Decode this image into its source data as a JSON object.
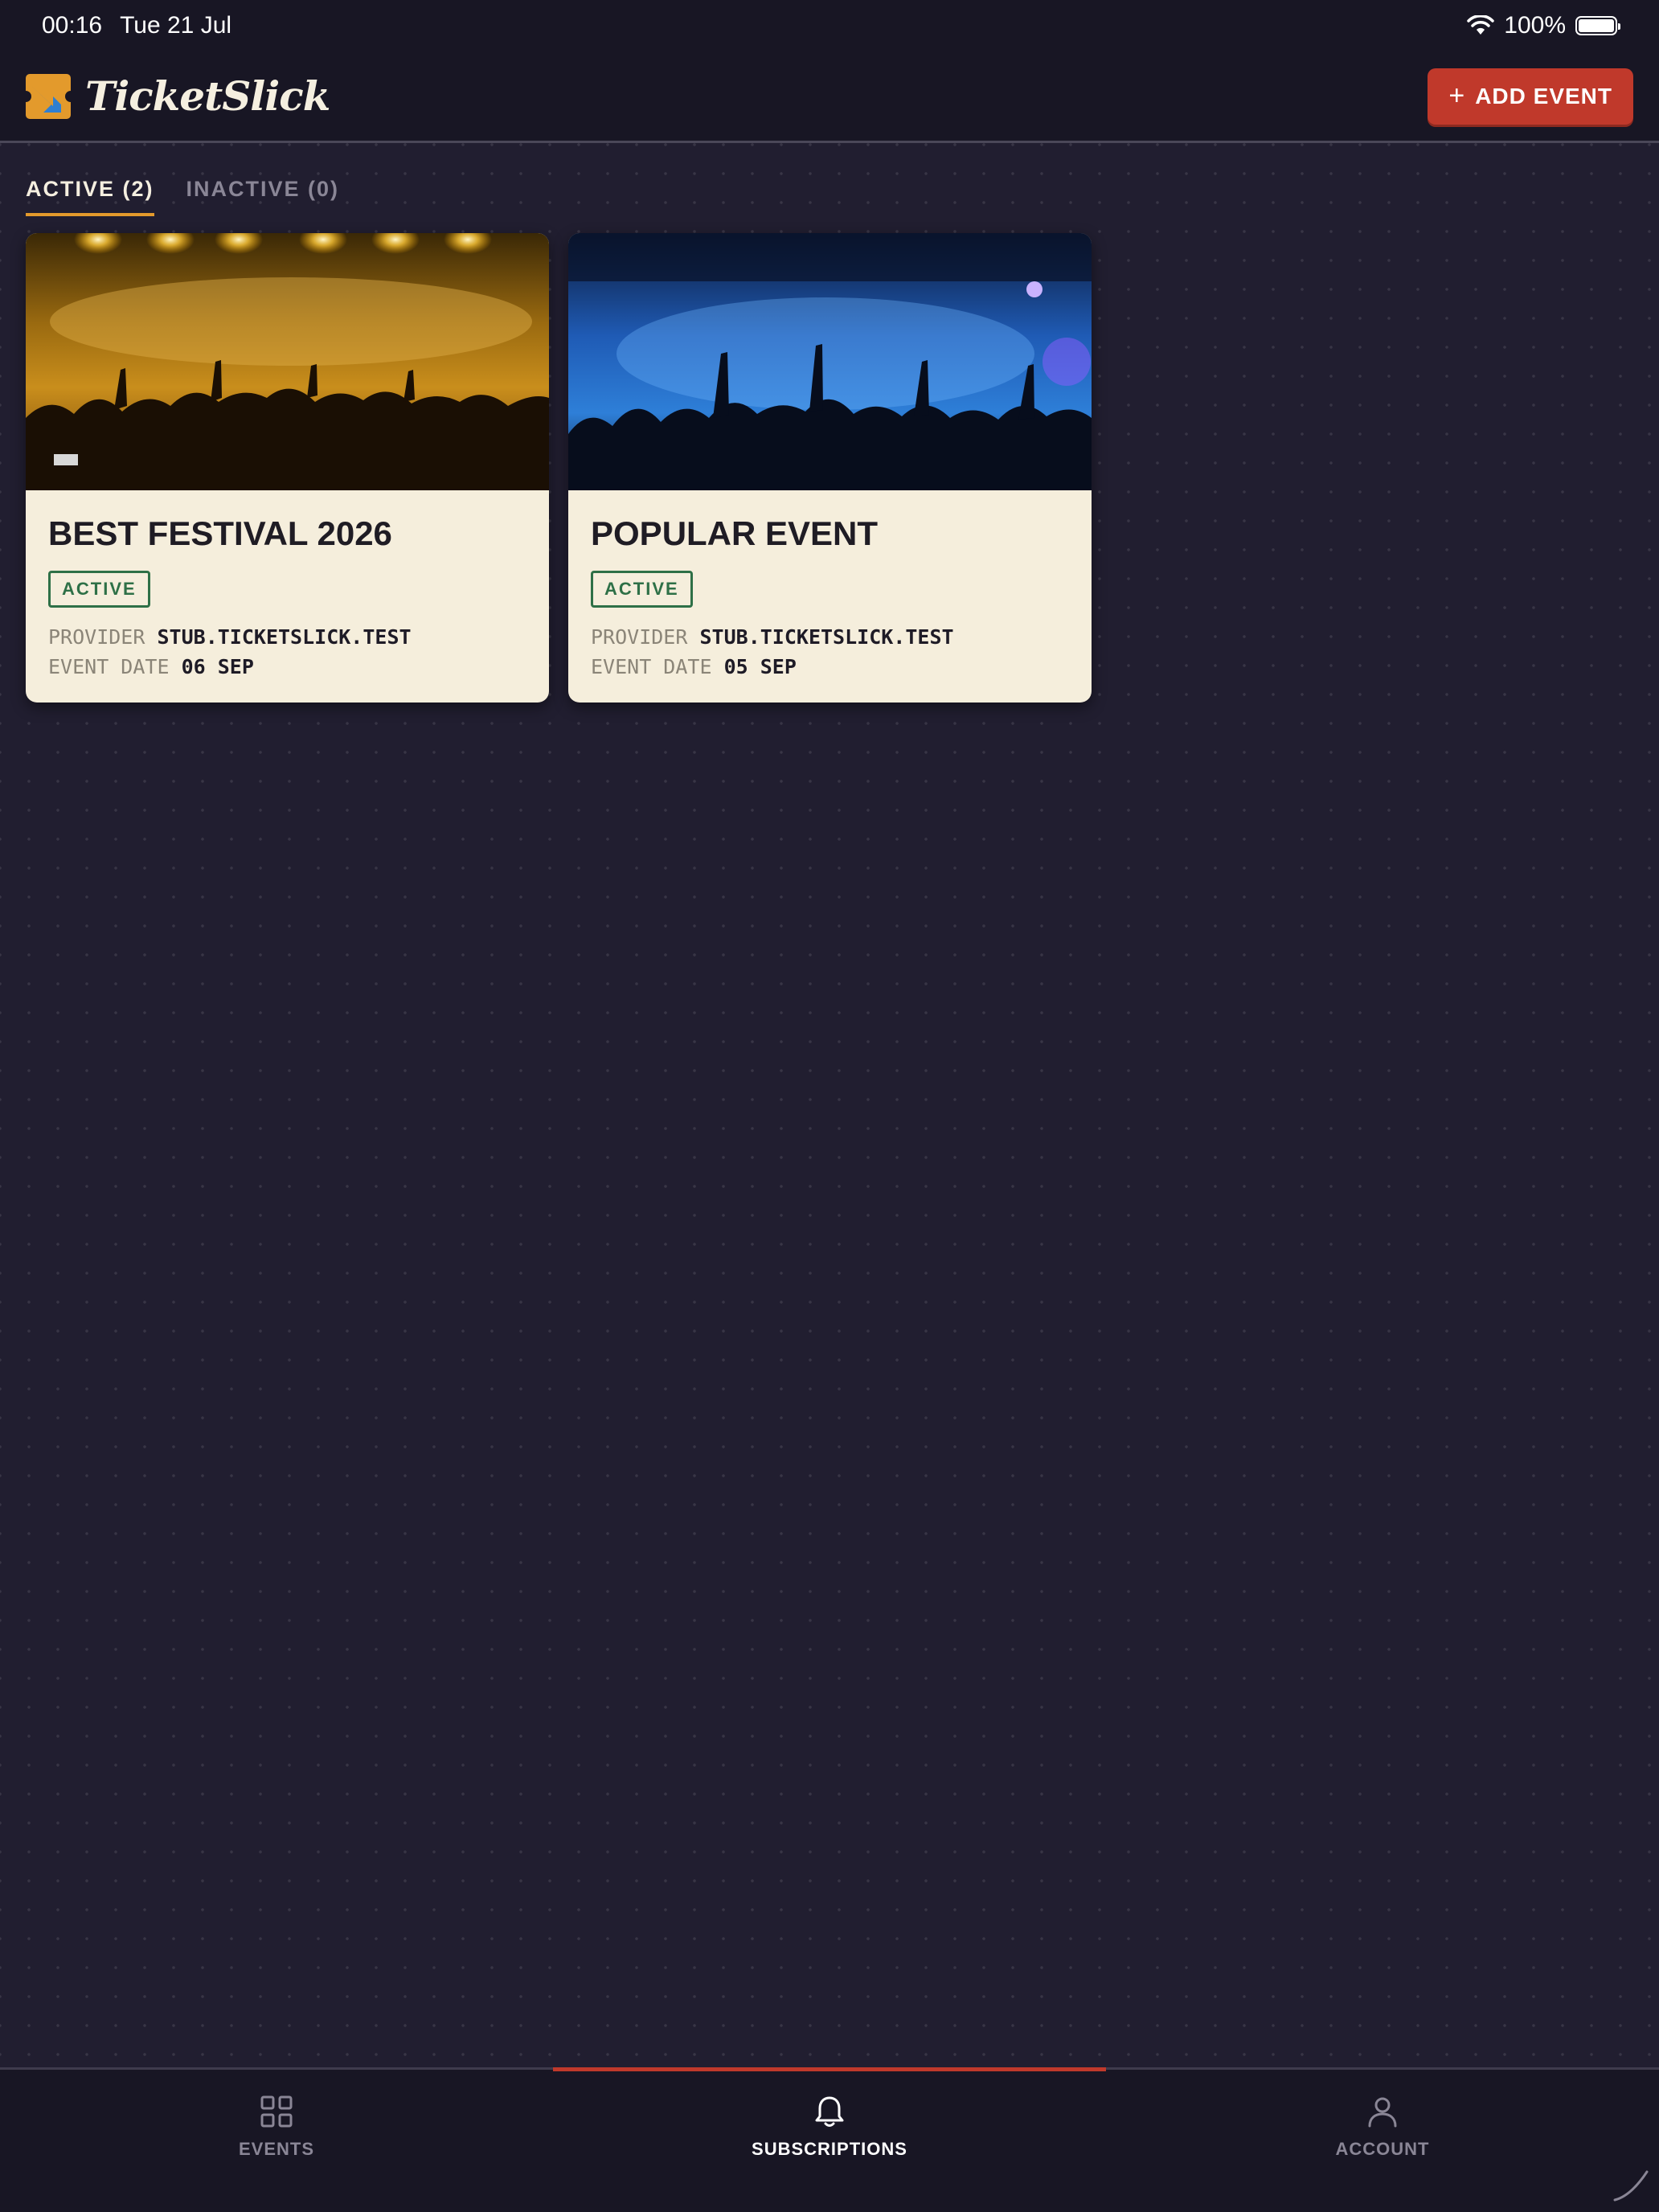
{
  "status_bar": {
    "time": "00:16",
    "date": "Tue 21 Jul",
    "battery_text": "100%",
    "wifi_icon": "wifi-icon",
    "battery_icon": "battery-icon"
  },
  "header": {
    "brand_name": "TicketSlick",
    "add_button_label": "ADD EVENT",
    "add_button_icon": "plus-icon",
    "accent_color": "#c0392b"
  },
  "tabs": [
    {
      "label": "ACTIVE (2)",
      "selected": true
    },
    {
      "label": "INACTIVE (0)",
      "selected": false
    }
  ],
  "events": [
    {
      "title": "BEST FESTIVAL 2026",
      "status": "ACTIVE",
      "provider_label": "PROVIDER",
      "provider": "STUB.TICKETSLICK.TEST",
      "date_label": "EVENT DATE",
      "date": "06 SEP",
      "image": "concert crowd under yellow stage lights"
    },
    {
      "title": "POPULAR EVENT",
      "status": "ACTIVE",
      "provider_label": "PROVIDER",
      "provider": "STUB.TICKETSLICK.TEST",
      "date_label": "EVENT DATE",
      "date": "05 SEP",
      "image": "concert crowd under blue stage lights"
    }
  ],
  "bottom_nav": [
    {
      "label": "EVENTS",
      "icon": "grid-icon",
      "selected": false
    },
    {
      "label": "SUBSCRIPTIONS",
      "icon": "bell-icon",
      "selected": true
    },
    {
      "label": "ACCOUNT",
      "icon": "person-icon",
      "selected": false
    }
  ],
  "colors": {
    "background": "#211e30",
    "card": "#f5eedc",
    "active_tab_underline": "#e39a2c",
    "status_green": "#2e7047"
  }
}
